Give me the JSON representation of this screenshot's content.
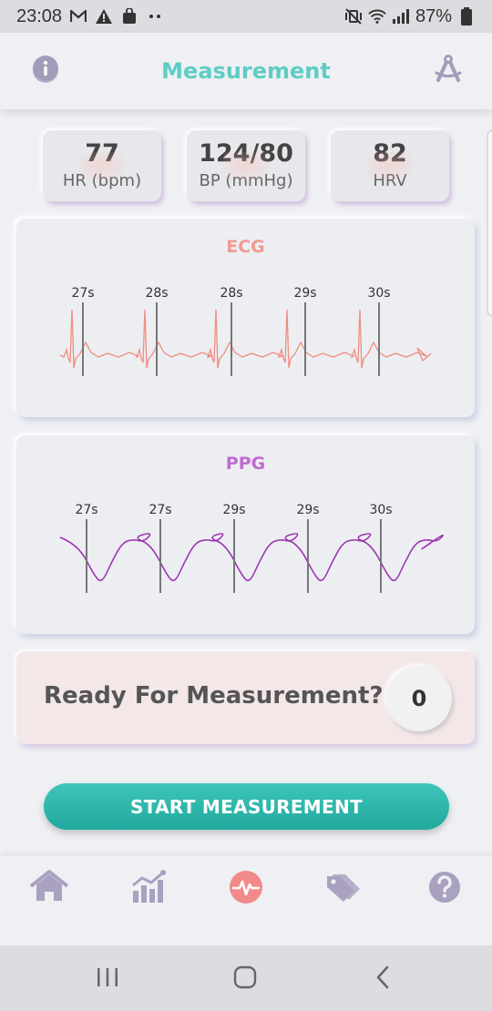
{
  "status_bar": {
    "time": "23:08",
    "left_icons": [
      "gmail-icon",
      "warning-icon",
      "bag-icon",
      "more-dots-icon"
    ],
    "right_icons": [
      "mute-vibrate-icon",
      "wifi-icon",
      "signal-icon",
      "battery-icon"
    ],
    "battery": "87%"
  },
  "header": {
    "title": "Measurement",
    "left_icon": "info-icon",
    "right_icon": "compass-tool-icon"
  },
  "metrics": [
    {
      "value": "77",
      "label": "HR (bpm)"
    },
    {
      "value": "124/80",
      "label": "BP (mmHg)"
    },
    {
      "value": "82",
      "label": "HRV"
    }
  ],
  "ecg": {
    "title": "ECG",
    "color": "#f08d80",
    "title_color": "#f29a92",
    "markers": [
      "27s",
      "28s",
      "28s",
      "29s",
      "30s"
    ]
  },
  "ppg": {
    "title": "PPG",
    "color": "#9b2fae",
    "title_color": "#c06bd0",
    "markers": [
      "27s",
      "27s",
      "29s",
      "29s",
      "30s"
    ]
  },
  "ready": {
    "text": "Ready For Measurement?",
    "count": "0"
  },
  "start_button": {
    "label": "START MEASUREMENT"
  },
  "bottom_nav": {
    "items": [
      {
        "icon": "home-icon",
        "active": false
      },
      {
        "icon": "stats-chart-icon",
        "active": false
      },
      {
        "icon": "heart-pulse-icon",
        "active": true
      },
      {
        "icon": "tags-icon",
        "active": false
      },
      {
        "icon": "help-icon",
        "active": false
      }
    ],
    "accent": "#f28a8a",
    "inactive": "#a9a1bf"
  },
  "android_nav": [
    "recents-icon",
    "home-circle-icon",
    "back-icon"
  ]
}
